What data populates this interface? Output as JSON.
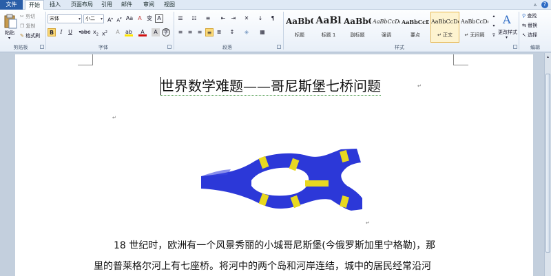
{
  "tabs": [
    "文件",
    "开始",
    "插入",
    "页面布局",
    "引用",
    "邮件",
    "审阅",
    "视图"
  ],
  "clipboard": {
    "paste": "粘贴",
    "cut": "剪切",
    "copy": "复制",
    "format_painter": "格式刷",
    "group": "剪贴板"
  },
  "font": {
    "name": "宋体",
    "size": "小二",
    "group": "字体"
  },
  "paragraph": {
    "group": "段落"
  },
  "styles": {
    "items": [
      {
        "sample": "AaBbC",
        "name": "标题"
      },
      {
        "sample": "AaBl",
        "name": "标题 1"
      },
      {
        "sample": "AaBbC",
        "name": "副标题"
      },
      {
        "sample": "AaBbCcDd",
        "name": "强调"
      },
      {
        "sample": "AaBbCcD",
        "name": "要点"
      },
      {
        "sample": "AaBbCcDd",
        "name": "↵ 正文"
      },
      {
        "sample": "AaBbCcDd",
        "name": "↵ 无间隔"
      }
    ],
    "change_styles": "更改样式",
    "group": "样式"
  },
  "editing": {
    "find": "查找",
    "replace": "替换",
    "select": "选择",
    "group": "编辑"
  },
  "document": {
    "title": "世界数学难题——哥尼斯堡七桥问题",
    "para_mark": "↵",
    "line1": "18 世纪时，欧洲有一个风景秀丽的小城哥尼斯堡(今俄罗斯加里宁格勒)，那",
    "line2": "里的普莱格尔河上有七座桥。将河中的两个岛和河岸连结，城中的居民经常沿河"
  },
  "colors": {
    "river": "#2c38d8",
    "bridge": "#e8d820",
    "file_tab": "#2a5ea8"
  }
}
